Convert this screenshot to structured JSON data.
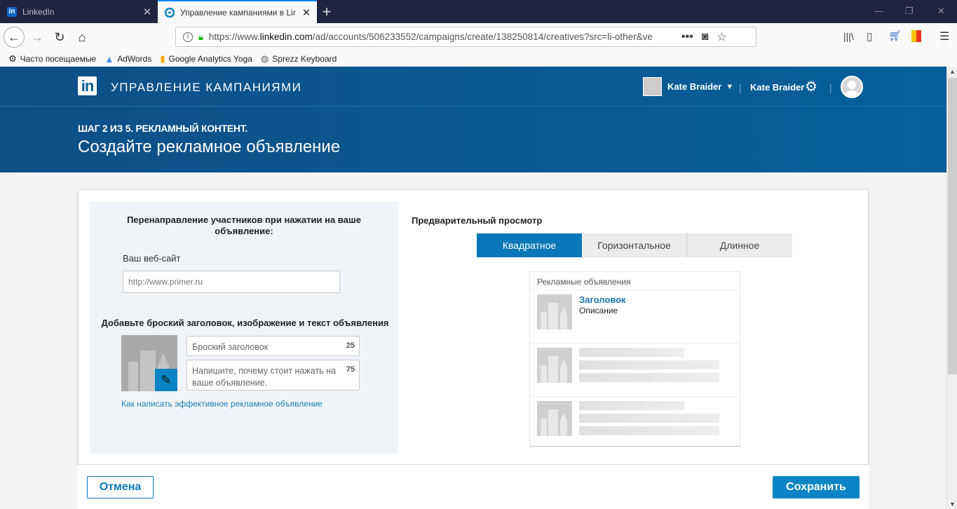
{
  "browser": {
    "tabs": [
      {
        "label": "LinkedIn",
        "icon": "linkedin-icon",
        "active": false
      },
      {
        "label": "Управление кампаниями в LinkedIn",
        "icon": "campaign-manager-icon",
        "active": true
      }
    ],
    "url": {
      "prefix": "https://www.",
      "domain": "linkedin.com",
      "path": "/ad/accounts/506233552/campaigns/create/138250814/creatives?src=li-other&ve"
    },
    "bookmarks": [
      {
        "label": "Часто посещаемые",
        "icon": "gear-icon"
      },
      {
        "label": "AdWords",
        "icon": "adwords-icon"
      },
      {
        "label": "Google Analytics Yoga",
        "icon": "analytics-icon"
      },
      {
        "label": "Sprezz Keyboard",
        "icon": "globe-icon"
      }
    ]
  },
  "header": {
    "app_title": "УПРАВЛЕНИЕ КАМПАНИЯМИ",
    "account_name": "Kate Braider",
    "user_name": "Kate Braider",
    "step": "ШАГ 2 ИЗ 5. РЕКЛАМНЫЙ КОНТЕНТ.",
    "page_title": "Создайте рекламное объявление"
  },
  "left": {
    "redirect_heading": "Перенаправление участников при нажатии на ваше объявление:",
    "website_label": "Ваш веб-сайт",
    "website_placeholder": "http://www.primer.ru",
    "creative_heading": "Добавьте броский заголовок, изображение и текст объявления",
    "headline_placeholder": "Броский заголовок",
    "headline_count": "25",
    "description_placeholder": "Напишите, почему стоит нажать на ваше объявление.",
    "description_count": "75",
    "help_link": "Как написать эффективное рекламное объявление"
  },
  "preview": {
    "heading": "Предварительный просмотр",
    "tabs": [
      {
        "label": "Квадратное",
        "active": true
      },
      {
        "label": "Горизонтальное",
        "active": false
      },
      {
        "label": "Длинное",
        "active": false
      }
    ],
    "box_header": "Рекламные объявления",
    "ad_title": "Заголовок",
    "ad_description": "Описание"
  },
  "footer": {
    "cancel_label": "Отмена",
    "save_label": "Сохранить"
  },
  "colors": {
    "brand": "#0a78b8",
    "header_bg": "#0f4f86",
    "link": "#1e80b3"
  }
}
